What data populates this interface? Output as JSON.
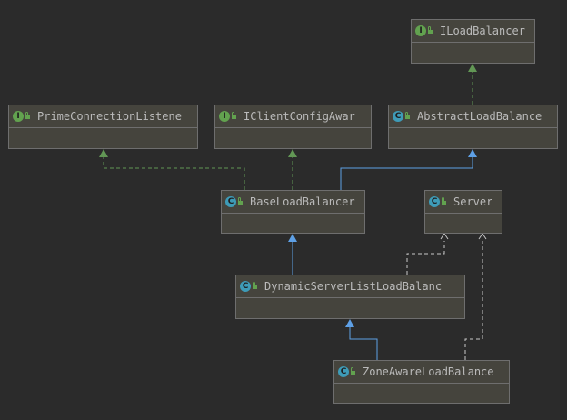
{
  "colors": {
    "background": "#2b2b2b",
    "node_fill": "#45443d",
    "node_border": "#6e6e6e",
    "label": "#bbbbbb",
    "implements_edge": "#629755",
    "extends_edge": "#5ea0e6",
    "dependency_edge": "#c8c8c8",
    "interface_badge": "#62a24f",
    "class_badge": "#3e9bb7"
  },
  "badges": {
    "interface": "I",
    "class": "C"
  },
  "nodes": [
    {
      "id": "ILoadBalancer",
      "label": "ILoadBalancer",
      "kind": "interface"
    },
    {
      "id": "PrimeConnectionListener",
      "label": "PrimeConnectionListene",
      "kind": "interface"
    },
    {
      "id": "IClientConfigAware",
      "label": "IClientConfigAwar",
      "kind": "interface"
    },
    {
      "id": "AbstractLoadBalancer",
      "label": "AbstractLoadBalance",
      "kind": "class"
    },
    {
      "id": "BaseLoadBalancer",
      "label": "BaseLoadBalancer",
      "kind": "class"
    },
    {
      "id": "Server",
      "label": "Server",
      "kind": "class"
    },
    {
      "id": "DynamicServerListLoadBalancer",
      "label": "DynamicServerListLoadBalanc",
      "kind": "class"
    },
    {
      "id": "ZoneAwareLoadBalancer",
      "label": "ZoneAwareLoadBalance",
      "kind": "class"
    }
  ],
  "edges": [
    {
      "from": "AbstractLoadBalancer",
      "to": "ILoadBalancer",
      "type": "implements"
    },
    {
      "from": "BaseLoadBalancer",
      "to": "PrimeConnectionListener",
      "type": "implements"
    },
    {
      "from": "BaseLoadBalancer",
      "to": "IClientConfigAware",
      "type": "implements"
    },
    {
      "from": "BaseLoadBalancer",
      "to": "AbstractLoadBalancer",
      "type": "extends"
    },
    {
      "from": "DynamicServerListLoadBalancer",
      "to": "BaseLoadBalancer",
      "type": "extends"
    },
    {
      "from": "DynamicServerListLoadBalancer",
      "to": "Server",
      "type": "dependency"
    },
    {
      "from": "ZoneAwareLoadBalancer",
      "to": "DynamicServerListLoadBalancer",
      "type": "extends"
    },
    {
      "from": "ZoneAwareLoadBalancer",
      "to": "Server",
      "type": "dependency"
    }
  ]
}
